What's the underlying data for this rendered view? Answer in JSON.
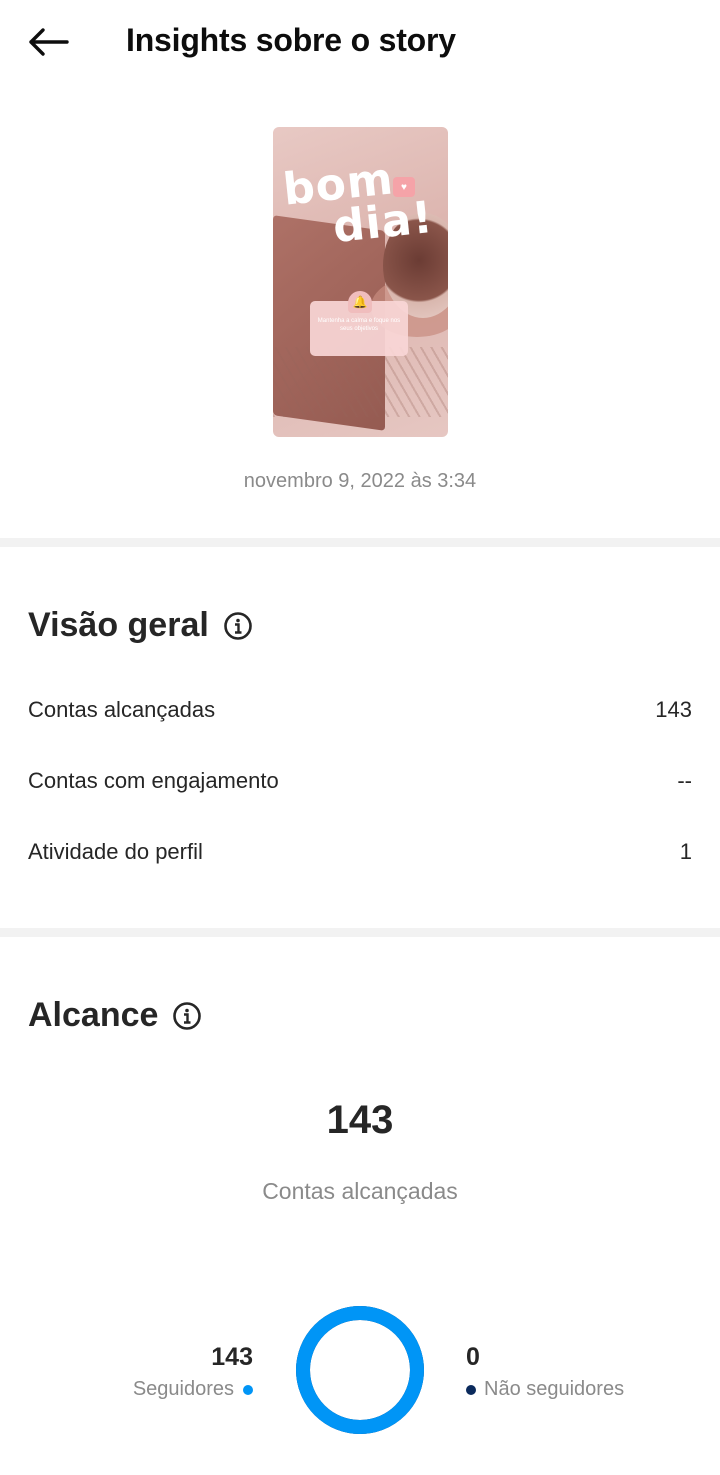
{
  "header": {
    "title": "Insights sobre o story"
  },
  "story": {
    "preview_text_line1": "bom",
    "preview_text_line2": "dia!",
    "card_text": "Mantenha a calma e foque nos seus objetivos",
    "date": "novembro 9, 2022 às 3:34"
  },
  "overview": {
    "title": "Visão geral",
    "metrics": [
      {
        "label": "Contas alcançadas",
        "value": "143"
      },
      {
        "label": "Contas com engajamento",
        "value": "--"
      },
      {
        "label": "Atividade do perfil",
        "value": "1"
      }
    ]
  },
  "reach": {
    "title": "Alcance",
    "total": "143",
    "total_label": "Contas alcançadas",
    "followers": {
      "value": "143",
      "label": "Seguidores",
      "color": "#0095f6"
    },
    "non_followers": {
      "value": "0",
      "label": "Não seguidores",
      "color": "#0a2a5c"
    },
    "follower_fraction": 1.0
  },
  "colors": {
    "accent": "#0095f6",
    "divider": "#f2f2f2",
    "muted_text": "#8a8a8a"
  },
  "icons": {
    "back": "arrow-left-icon",
    "info": "info-circle-icon"
  }
}
